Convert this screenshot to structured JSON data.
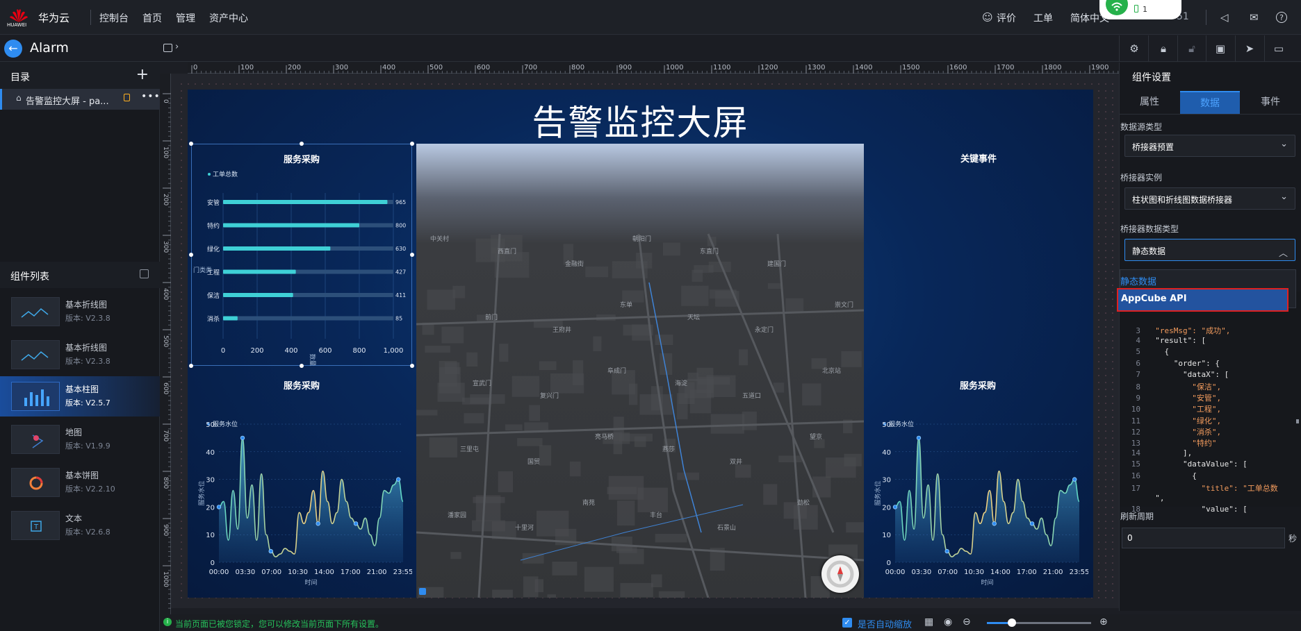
{
  "topbar": {
    "logo_text": "HUAWEI",
    "brand": "华为云",
    "nav": [
      "控制台",
      "首页",
      "管理",
      "资产中心"
    ],
    "right": {
      "feedback": "评价",
      "ticket": "工单",
      "language": "简体中文",
      "account": "51"
    },
    "wifi_popup": "1"
  },
  "appbar": {
    "title": "Alarm"
  },
  "left": {
    "catalog_title": "目录",
    "page_item": "告警监控大屏 - pa...",
    "components_title": "组件列表",
    "components": [
      {
        "name": "基本折线图",
        "version": "版本: V2.3.8"
      },
      {
        "name": "基本折线图",
        "version": "版本: V2.3.8"
      },
      {
        "name": "基本柱图",
        "version": "版本: V2.5.7"
      },
      {
        "name": "地图",
        "version": "版本: V1.9.9"
      },
      {
        "name": "基本饼图",
        "version": "版本: V2.2.10"
      },
      {
        "name": "文本",
        "version": "版本: V2.6.8"
      }
    ]
  },
  "ruler": {
    "h_ticks": [
      "0",
      "100",
      "200",
      "300",
      "400",
      "500",
      "600",
      "700",
      "800",
      "900",
      "1000",
      "1100",
      "1200",
      "1300",
      "1400",
      "1500",
      "1600",
      "1700",
      "1800",
      "1900"
    ],
    "v_ticks": [
      "0",
      "100",
      "200",
      "300",
      "400",
      "500",
      "600",
      "700",
      "800",
      "900",
      "1000"
    ]
  },
  "stage": {
    "title": "告警监控大屏",
    "bar_title": "服务采购",
    "bar_legend": "工单总数",
    "bar_side_label": "门类类",
    "bar_x_label": "数量",
    "events_title": "关键事件",
    "line_left_title": "服务采购",
    "line_right_title": "服务采购",
    "line_legend": "服务水位",
    "line_y_label": "服务水位",
    "line_x_label": "时间",
    "map_places": [
      "中关村",
      "西直门",
      "金融街",
      "朝阳门",
      "东直门",
      "建国门",
      "崇文门",
      "前门",
      "王府井",
      "东单",
      "天坛",
      "永定门",
      "北京站",
      "宣武门",
      "复兴门",
      "阜成门",
      "海淀",
      "五道口",
      "望京",
      "三里屯",
      "国贸",
      "亮马桥",
      "燕莎",
      "双井",
      "劲松",
      "潘家园",
      "十里河",
      "南苑",
      "丰台",
      "石景山"
    ]
  },
  "chart_data": [
    {
      "type": "bar",
      "orientation": "horizontal",
      "title": "服务采购",
      "legend": [
        "工单总数"
      ],
      "categories": [
        "安管",
        "特约",
        "绿化",
        "工程",
        "保洁",
        "消杀"
      ],
      "values": [
        965,
        800,
        630,
        427,
        411,
        85
      ],
      "xlim": [
        0,
        1000
      ],
      "x_ticks": [
        "0",
        "200",
        "400",
        "600",
        "800",
        "1,000"
      ],
      "xlabel": "数量"
    },
    {
      "type": "area",
      "title": "服务采购",
      "legend": [
        "服务水位"
      ],
      "x_ticks": [
        "00:00",
        "03:30",
        "07:00",
        "10:30",
        "14:00",
        "17:00",
        "21:00",
        "23:55"
      ],
      "y_ticks": [
        "0",
        "10",
        "20",
        "30",
        "40",
        "50"
      ],
      "ylim": [
        0,
        50
      ],
      "ylabel": "服务水位",
      "xlabel": "时间",
      "values": [
        20,
        22,
        8,
        26,
        12,
        45,
        16,
        28,
        8,
        32,
        10,
        4,
        2,
        3,
        5,
        4,
        3,
        18,
        14,
        18,
        26,
        14,
        33,
        22,
        14,
        18,
        30,
        22,
        16,
        14,
        12,
        16,
        10,
        6,
        16,
        26,
        25,
        28,
        30,
        22
      ]
    },
    {
      "type": "area",
      "title": "服务采购",
      "legend": [
        "服务水位"
      ],
      "x_ticks": [
        "00:00",
        "03:30",
        "07:00",
        "10:30",
        "14:00",
        "17:00",
        "21:00",
        "23:55"
      ],
      "y_ticks": [
        "0",
        "10",
        "20",
        "30",
        "40",
        "50"
      ],
      "ylim": [
        0,
        50
      ],
      "ylabel": "服务水位",
      "xlabel": "时间",
      "values": [
        20,
        22,
        8,
        26,
        12,
        45,
        16,
        28,
        8,
        32,
        10,
        4,
        2,
        3,
        5,
        4,
        3,
        18,
        14,
        18,
        26,
        14,
        33,
        22,
        14,
        18,
        30,
        22,
        16,
        14,
        12,
        16,
        10,
        6,
        16,
        26,
        25,
        28,
        30,
        22
      ]
    }
  ],
  "right": {
    "panel_title": "组件设置",
    "tabs": [
      "属性",
      "数据",
      "事件"
    ],
    "datasource_label": "数据源类型",
    "datasource_value": "桥接器预置",
    "bridge_label": "桥接器实例",
    "bridge_value": "柱状图和折线图数据桥接器",
    "bridge_type_label": "桥接器数据类型",
    "bridge_type_value": "静态数据",
    "dropdown_options": [
      "静态数据",
      "AppCube API"
    ],
    "code_lines": [
      {
        "n": "3",
        "t": "  \"resMsg\": \"成功\","
      },
      {
        "n": "4",
        "t": "  \"result\": ["
      },
      {
        "n": "5",
        "t": "    {"
      },
      {
        "n": "6",
        "t": "      \"order\": {"
      },
      {
        "n": "7",
        "t": "        \"dataX\": ["
      },
      {
        "n": "8",
        "t": "          \"保洁\","
      },
      {
        "n": "9",
        "t": "          \"安管\","
      },
      {
        "n": "10",
        "t": "          \"工程\","
      },
      {
        "n": "11",
        "t": "          \"绿化\","
      },
      {
        "n": "12",
        "t": "          \"消杀\","
      },
      {
        "n": "13",
        "t": "          \"特约\""
      },
      {
        "n": "14",
        "t": "        ],"
      },
      {
        "n": "15",
        "t": "        \"dataValue\": ["
      },
      {
        "n": "16",
        "t": "          {"
      },
      {
        "n": "17",
        "t": "            \"title\": \"工单总数"
      },
      {
        "n": "",
        "t": "  \","
      },
      {
        "n": "18",
        "t": "            \"value\": ["
      }
    ],
    "refresh_label": "刷新周期",
    "refresh_value": "0",
    "refresh_unit": "秒"
  },
  "status": {
    "message": "当前页面已被您锁定，您可以修改当前页面下所有设置。",
    "auto_zoom": "是否自动缩放"
  },
  "colors": {
    "accent": "#2f8cf0",
    "bar": "#3fd0d6",
    "alert_border": "#e02020"
  }
}
